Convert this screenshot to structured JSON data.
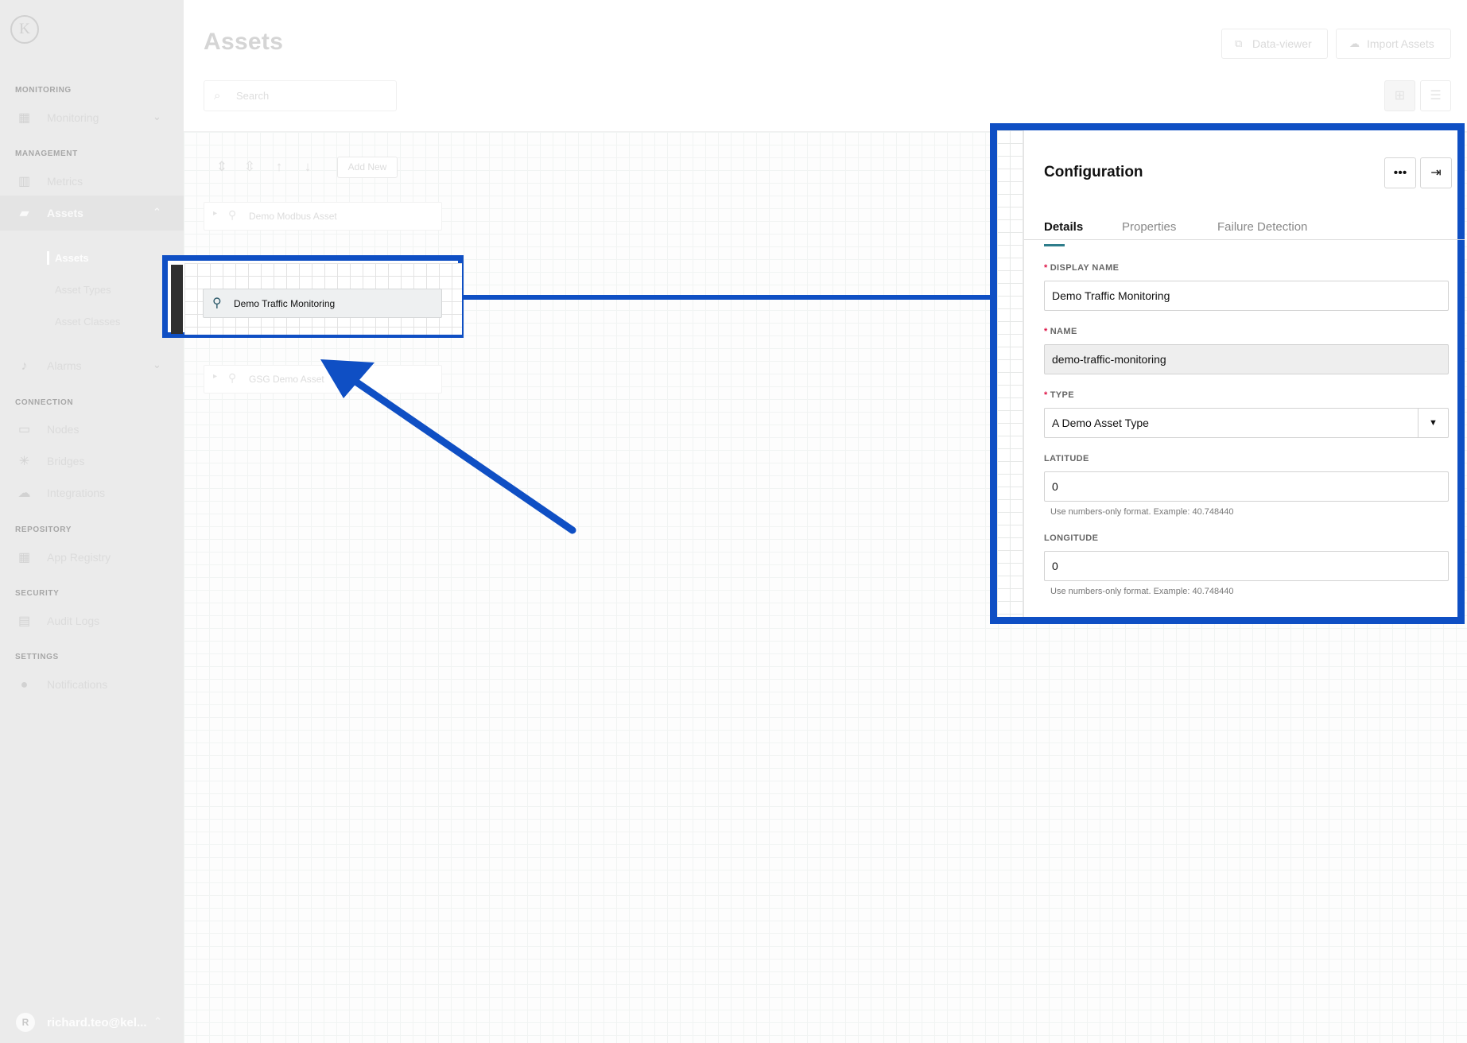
{
  "app": {
    "logo_letter": "K"
  },
  "sidebar": {
    "sections": {
      "monitoring": "MONITORING",
      "management": "MANAGEMENT",
      "connection": "CONNECTION",
      "repository": "REPOSITORY",
      "security": "SECURITY",
      "settings": "SETTINGS"
    },
    "items": [
      {
        "label": "Monitoring",
        "icon": "dashboard-icon"
      },
      {
        "label": "Metrics",
        "icon": "chart-icon"
      },
      {
        "label": "Assets",
        "icon": "assets-icon"
      },
      {
        "label": "Alarms",
        "icon": "bell-icon"
      },
      {
        "label": "Nodes",
        "icon": "nodes-icon"
      },
      {
        "label": "Bridges",
        "icon": "bridges-icon"
      },
      {
        "label": "Integrations",
        "icon": "cloud-icon"
      },
      {
        "label": "App Registry",
        "icon": "grid-icon"
      },
      {
        "label": "Audit Logs",
        "icon": "clipboard-icon"
      },
      {
        "label": "Notifications",
        "icon": "notification-icon"
      }
    ],
    "asset_sub": [
      "Assets",
      "Asset Types",
      "Asset Classes"
    ],
    "user": {
      "initial": "R",
      "name": "richard.teo@kel..."
    }
  },
  "header": {
    "title": "Assets",
    "data_viewer": "Data-viewer",
    "import_assets": "Import Assets",
    "search_placeholder": "Search"
  },
  "toolbar": {
    "add_new": "Add New"
  },
  "tree": {
    "nodes": [
      "Demo Modbus Asset",
      "GSG Demo Asset"
    ],
    "selected": "Demo Traffic Monitoring"
  },
  "config": {
    "title": "Configuration",
    "tabs": [
      "Details",
      "Properties",
      "Failure Detection"
    ],
    "display_name_label": "DISPLAY NAME",
    "display_name_value": "Demo Traffic Monitoring",
    "name_label": "NAME",
    "name_value": "demo-traffic-monitoring",
    "type_label": "TYPE",
    "type_value": "A Demo Asset Type",
    "latitude_label": "LATITUDE",
    "latitude_value": "0",
    "longitude_label": "LONGITUDE",
    "longitude_value": "0",
    "coord_hint": "Use numbers-only format. Example: 40.748440"
  },
  "colors": {
    "highlight": "#0f4fc4",
    "tab_accent": "#2e7d8b"
  }
}
